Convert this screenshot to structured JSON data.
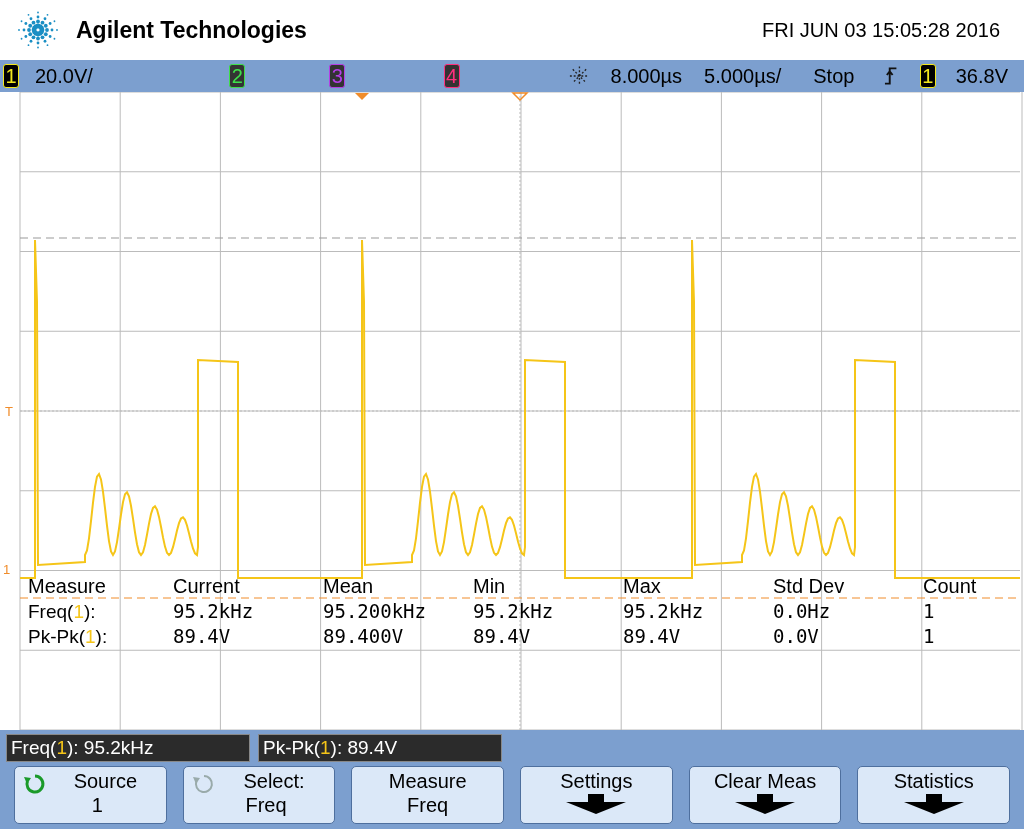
{
  "header": {
    "brand": "Agilent Technologies",
    "datetime": "FRI JUN 03 15:05:28 2016"
  },
  "status_bar": {
    "channels": [
      {
        "number": "1",
        "color": "#f2e81e",
        "on": true,
        "scale": "20.0V/"
      },
      {
        "number": "2",
        "color": "#3ee04a",
        "on": false
      },
      {
        "number": "3",
        "color": "#b43ee8",
        "on": false
      },
      {
        "number": "4",
        "color": "#ff2f7e",
        "on": false
      }
    ],
    "delay": "8.000µs",
    "timebase": "5.000µs/",
    "run_state": "Stop",
    "trigger_source": "1",
    "trigger_level": "36.8V"
  },
  "graticule": {
    "trigger_marker": "T",
    "ground_marker": "1"
  },
  "measurements": {
    "columns": [
      "Measure",
      "Current",
      "Mean",
      "Min",
      "Max",
      "Std Dev",
      "Count"
    ],
    "rows": [
      {
        "name": "Freq(",
        "channel": "1",
        "suffix": "):",
        "values": [
          "95.2kHz",
          "95.200kHz",
          "95.2kHz",
          "95.2kHz",
          "0.0Hz",
          "1"
        ]
      },
      {
        "name": "Pk-Pk(",
        "channel": "1",
        "suffix": "):",
        "values": [
          "89.4V",
          "89.400V",
          "89.4V",
          "89.4V",
          "0.0V",
          "1"
        ]
      }
    ]
  },
  "readouts": [
    {
      "name": "Freq(",
      "channel": "1",
      "value": "): 95.2kHz"
    },
    {
      "name": "Pk-Pk(",
      "channel": "1",
      "value": "): 89.4V"
    }
  ],
  "softkeys": [
    {
      "kind": "cycle",
      "label": "Source",
      "value": "1",
      "disabled": false
    },
    {
      "kind": "cycle",
      "label": "Select:",
      "value": "Freq",
      "disabled": true
    },
    {
      "kind": "plain",
      "label": "Measure",
      "value": "Freq"
    },
    {
      "kind": "menu",
      "label": "Settings"
    },
    {
      "kind": "menu",
      "label": "Clear Meas"
    },
    {
      "kind": "menu",
      "label": "Statistics"
    }
  ]
}
